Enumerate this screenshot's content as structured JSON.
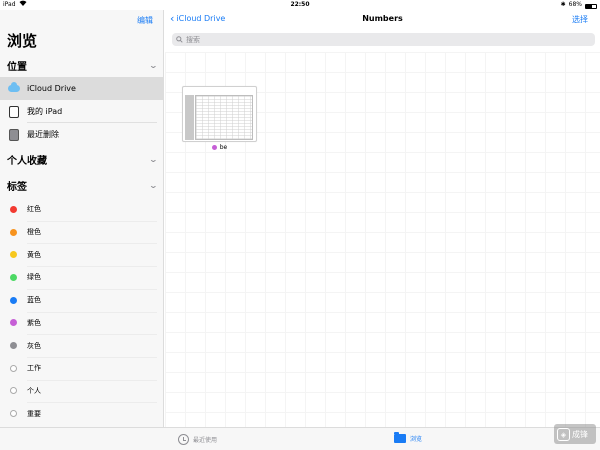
{
  "status_bar": {
    "device": "iPad",
    "time": "22:50",
    "battery": "68%",
    "wifi_icon": "wifi-icon",
    "bluetooth_icon": "bluetooth-icon"
  },
  "sidebar": {
    "edit_label": "编辑",
    "title": "浏览",
    "locations_header": "位置",
    "locations": [
      {
        "label": "iCloud Drive",
        "icon": "icloud-icon",
        "selected": true
      },
      {
        "label": "我的 iPad",
        "icon": "ipad-icon",
        "selected": false
      },
      {
        "label": "最近删除",
        "icon": "trash-icon",
        "selected": false
      }
    ],
    "favorites_header": "个人收藏",
    "tags_header": "标签",
    "tags": [
      {
        "label": "红色",
        "color": "#f23a31"
      },
      {
        "label": "橙色",
        "color": "#f7931e"
      },
      {
        "label": "黄色",
        "color": "#f7c81e"
      },
      {
        "label": "绿色",
        "color": "#4cd964"
      },
      {
        "label": "蓝色",
        "color": "#1a7cf5"
      },
      {
        "label": "紫色",
        "color": "#c65fd6"
      },
      {
        "label": "灰色",
        "color": "#8e8e93"
      },
      {
        "label": "工作",
        "color": ""
      },
      {
        "label": "个人",
        "color": ""
      },
      {
        "label": "重要",
        "color": ""
      }
    ]
  },
  "main": {
    "back_label": "iCloud Drive",
    "title": "Numbers",
    "select_label": "选择",
    "search_placeholder": "搜索",
    "files": [
      {
        "name": "be",
        "tag_color": "#c65fd6"
      }
    ]
  },
  "tabbar": {
    "recent_label": "最近使用",
    "browse_label": "浏览"
  },
  "watermark": {
    "text": "成锋",
    "subtext": "7SH0.COM"
  },
  "colors": {
    "accent": "#1a7cf5"
  }
}
